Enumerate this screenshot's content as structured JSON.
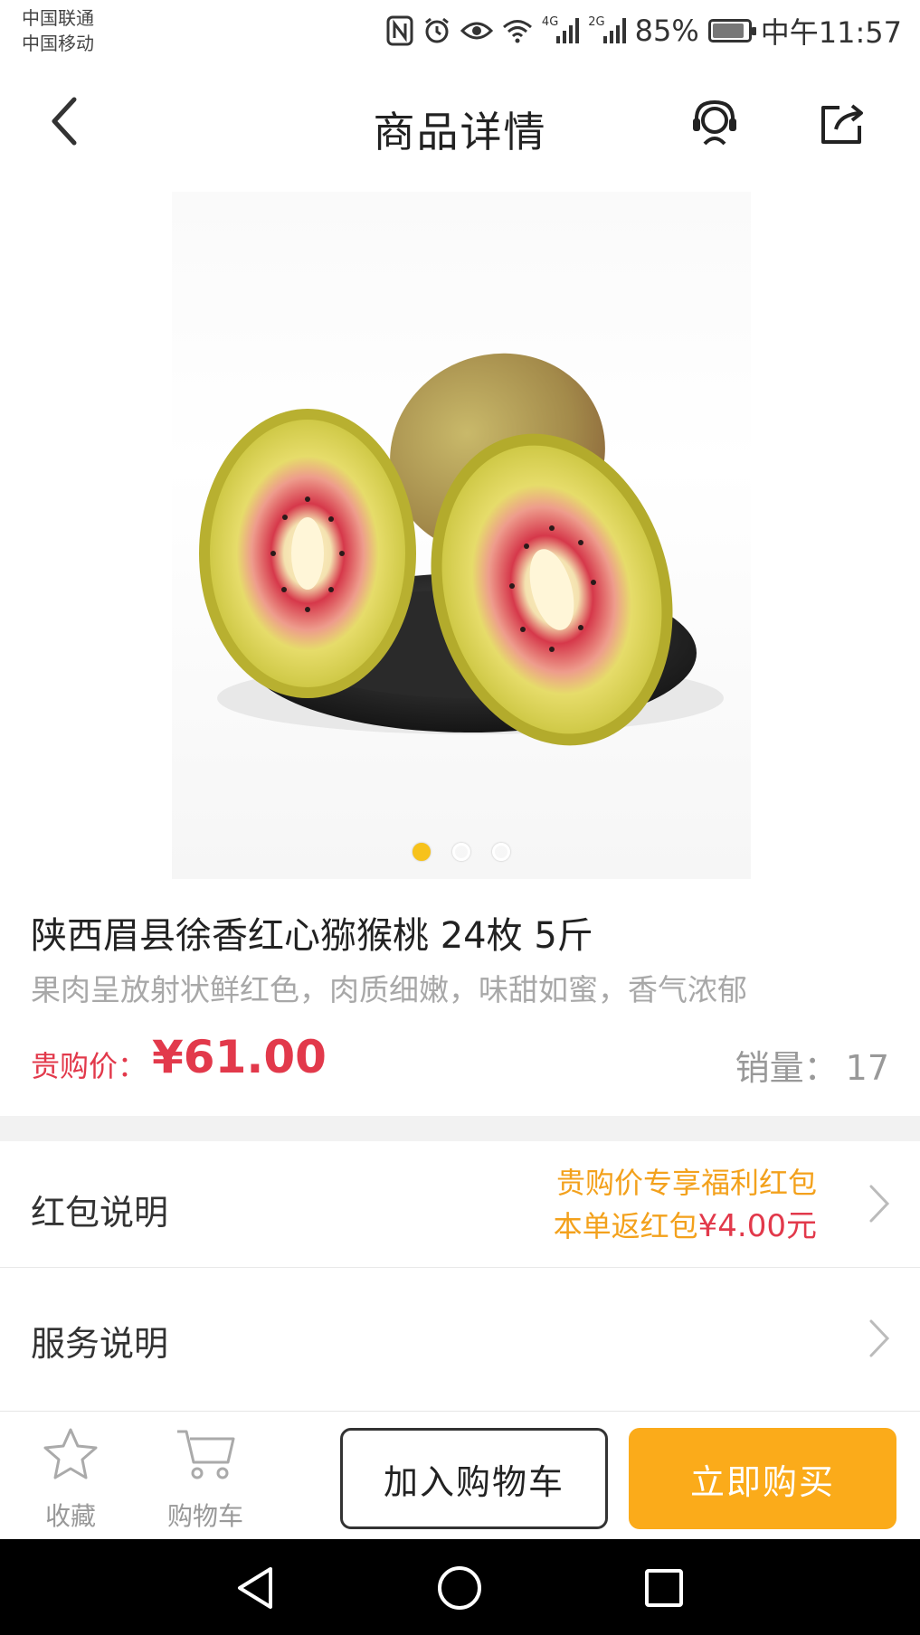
{
  "status_bar": {
    "carrier1": "中国联通",
    "carrier2": "中国移动",
    "net1": "4G",
    "net2": "2G",
    "battery": "85%",
    "time": "中午11:57"
  },
  "header": {
    "title": "商品详情"
  },
  "gallery": {
    "image_count": 3,
    "active_index": 0,
    "accent_color": "#f7c21b"
  },
  "product": {
    "name": "陕西眉县徐香红心猕猴桃 24枚 5斤",
    "description": "果肉呈放射状鲜红色，肉质细嫩，味甜如蜜，香气浓郁",
    "price_label": "贵购价：",
    "price": "¥61.00",
    "sales_label": "销量：",
    "sales_count": "17"
  },
  "redpack": {
    "label": "红包说明",
    "line1": "贵购价专享福利红包",
    "line2_prefix": "本单返红包",
    "line2_amount": "¥4.00元"
  },
  "service": {
    "label": "服务说明"
  },
  "action_bar": {
    "favorite_label": "收藏",
    "cart_label": "购物车",
    "add_to_cart": "加入购物车",
    "buy_now": "立即购买",
    "buy_color": "#fbab1a",
    "price_color": "#e2394b"
  }
}
